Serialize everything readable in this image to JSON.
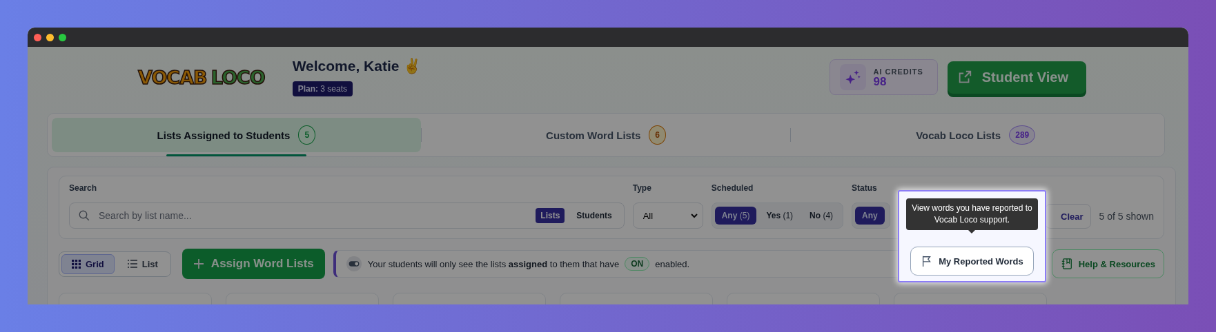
{
  "logo": {
    "words": [
      "VOCAB",
      "LOCO"
    ]
  },
  "welcome": "Welcome, Katie ✌️",
  "plan": "**Plan:** 3 seats",
  "credits": {
    "label": "AI CREDITS",
    "value": "98"
  },
  "student_view": "Student View",
  "tabs": [
    {
      "label": "Lists Assigned to Students",
      "count": "5",
      "selected": true
    },
    {
      "label": "Custom Word Lists",
      "count": "6",
      "selected": false
    },
    {
      "label": "Vocab Loco Lists",
      "count": "289",
      "selected": false
    }
  ],
  "search": {
    "label": "Search",
    "placeholder": "Search by list name...",
    "modes": [
      {
        "label": "Lists",
        "selected": true
      },
      {
        "label": "Students",
        "selected": false
      }
    ]
  },
  "type_filter": {
    "label": "Type",
    "value": "All"
  },
  "scheduled": {
    "label": "Scheduled",
    "options": [
      {
        "label": "Any",
        "count": "(5)",
        "selected": true
      },
      {
        "label": "Yes",
        "count": "(1)",
        "selected": false
      },
      {
        "label": "No",
        "count": "(4)",
        "selected": false
      }
    ]
  },
  "status": {
    "label": "Status",
    "options": [
      {
        "label": "Any",
        "selected": true
      }
    ]
  },
  "clear": "Clear",
  "shown": "5 of 5 shown",
  "view_toggle": [
    {
      "label": "Grid",
      "selected": true
    },
    {
      "label": "List",
      "selected": false
    }
  ],
  "assign_button": "Assign Word Lists",
  "notice": {
    "text": "Your students will only see the lists **assigned** to them that have",
    "badge": "ON",
    "tail": "enabled."
  },
  "reported_button": "My Reported Words",
  "help_button": "Help & Resources",
  "tooltip": "View words you have reported to Vocab Loco support."
}
